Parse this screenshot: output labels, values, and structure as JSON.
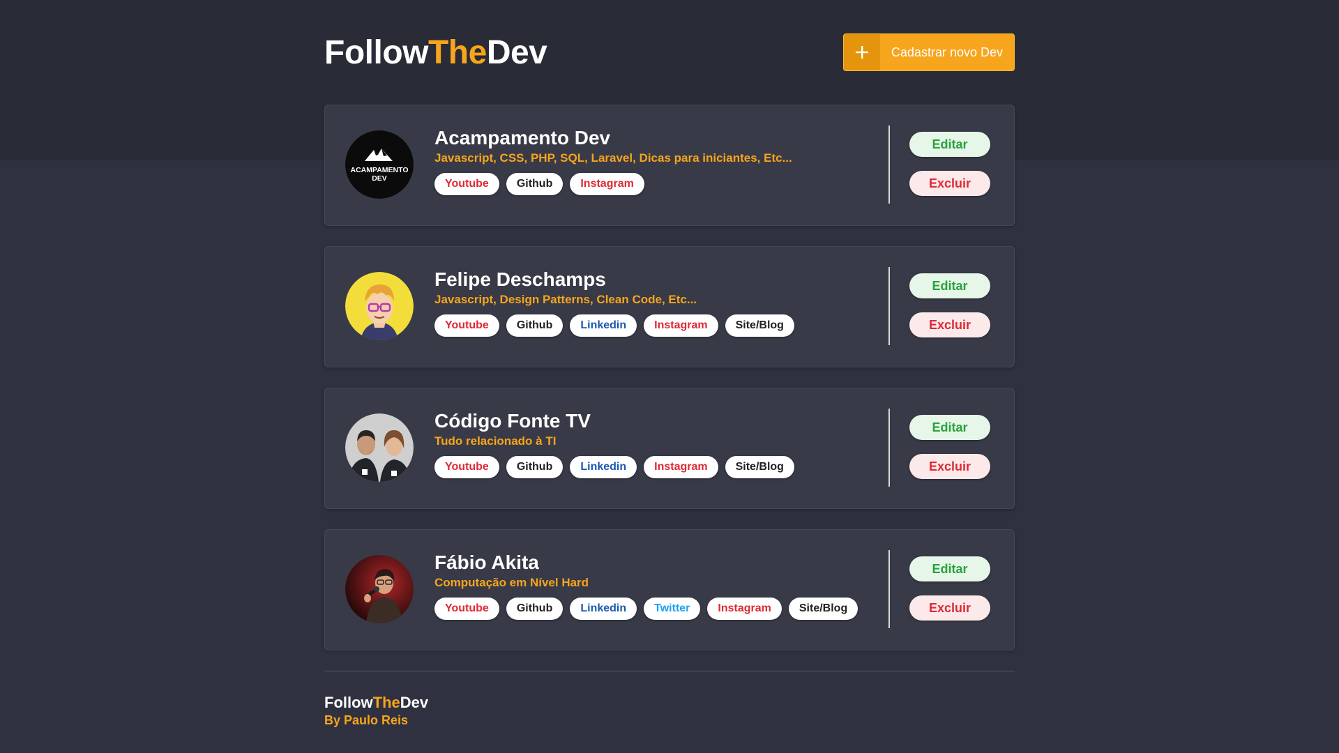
{
  "header": {
    "logo": {
      "part1": "Follow",
      "part2": "The",
      "part3": "Dev"
    },
    "add_button": {
      "icon": "plus-icon",
      "label": "Cadastrar novo Dev"
    }
  },
  "colors": {
    "accent": "#f7a51c",
    "background": "#2f3140",
    "card": "#383a47",
    "youtube": "#dd2a36",
    "github": "#222222",
    "linkedin": "#1a5ab0",
    "twitter": "#1da1f2",
    "instagram": "#dd2a36",
    "site": "#222222",
    "edit": "#27a23b",
    "delete": "#dd2a36"
  },
  "devs": [
    {
      "name": "Acampamento Dev",
      "description": "Javascript, CSS, PHP, SQL, Laravel, Dicas para iniciantes, Etc...",
      "avatar_text": "ACAMPAMENTO DEV",
      "links": [
        "Youtube",
        "Github",
        "Instagram"
      ],
      "edit_label": "Editar",
      "delete_label": "Excluir"
    },
    {
      "name": "Felipe Deschamps",
      "description": "Javascript, Design Patterns, Clean Code, Etc...",
      "links": [
        "Youtube",
        "Github",
        "Linkedin",
        "Instagram",
        "Site/Blog"
      ],
      "edit_label": "Editar",
      "delete_label": "Excluir"
    },
    {
      "name": "Código Fonte TV",
      "description": "Tudo relacionado à TI",
      "links": [
        "Youtube",
        "Github",
        "Linkedin",
        "Instagram",
        "Site/Blog"
      ],
      "edit_label": "Editar",
      "delete_label": "Excluir"
    },
    {
      "name": "Fábio Akita",
      "description": "Computação em Nível Hard",
      "links": [
        "Youtube",
        "Github",
        "Linkedin",
        "Twitter",
        "Instagram",
        "Site/Blog"
      ],
      "edit_label": "Editar",
      "delete_label": "Excluir"
    }
  ],
  "footer": {
    "logo": {
      "part1": "Follow",
      "part2": "The",
      "part3": "Dev"
    },
    "by": "By Paulo Reis"
  }
}
